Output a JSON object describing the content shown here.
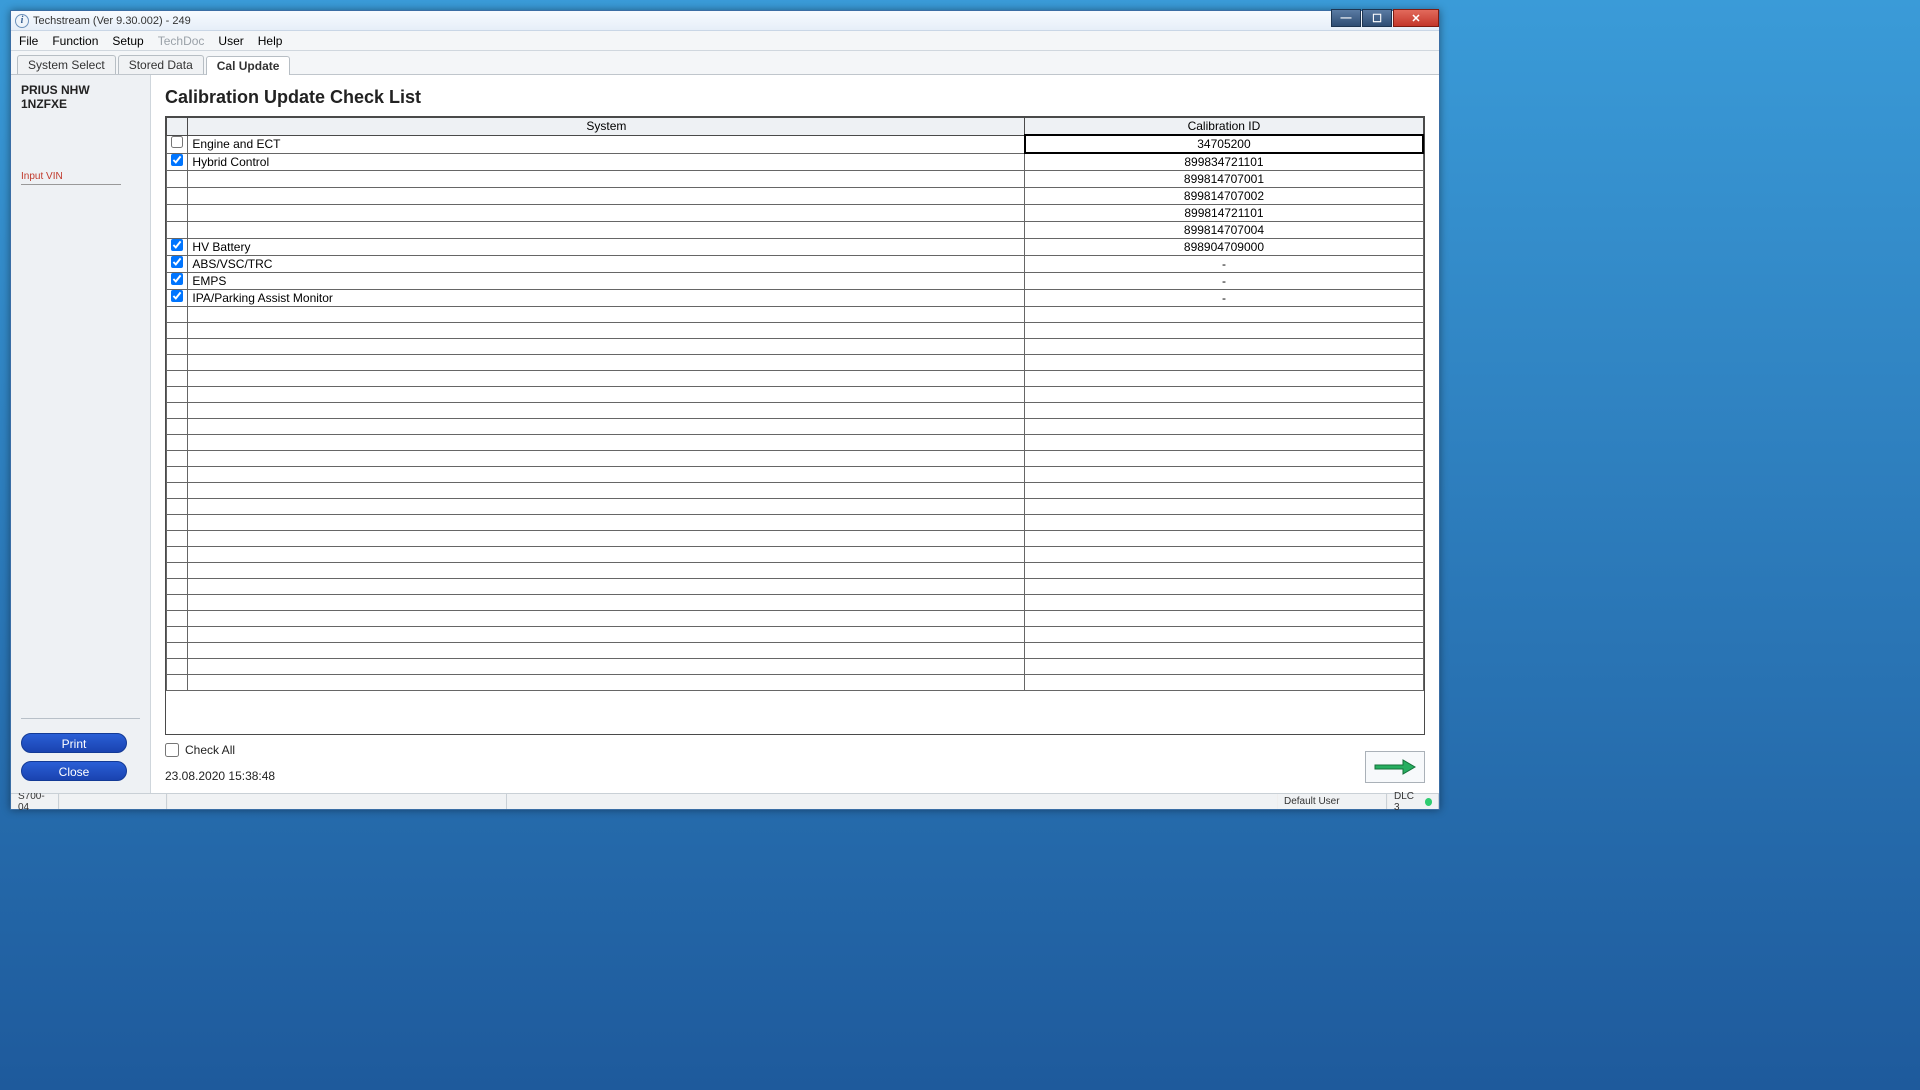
{
  "window": {
    "title": "Techstream (Ver 9.30.002) - 249"
  },
  "menu": {
    "items": [
      {
        "label": "File",
        "disabled": false
      },
      {
        "label": "Function",
        "disabled": false
      },
      {
        "label": "Setup",
        "disabled": false
      },
      {
        "label": "TechDoc",
        "disabled": true
      },
      {
        "label": "User",
        "disabled": false
      },
      {
        "label": "Help",
        "disabled": false
      }
    ]
  },
  "tabs": [
    {
      "label": "System Select",
      "active": false
    },
    {
      "label": "Stored Data",
      "active": false
    },
    {
      "label": "Cal Update",
      "active": true
    }
  ],
  "sidebar": {
    "vehicle_line1": "PRIUS NHW",
    "vehicle_line2": "1NZFXE",
    "input_vin_label": "Input VIN",
    "print_label": "Print",
    "close_label": "Close"
  },
  "main": {
    "title": "Calibration Update Check List",
    "columns": {
      "system": "System",
      "cal_id": "Calibration ID"
    },
    "rows": [
      {
        "checked": false,
        "system": "Engine and ECT",
        "cal": "34705200",
        "highlight": true
      },
      {
        "checked": true,
        "system": "Hybrid Control",
        "cal": "899834721101"
      },
      {
        "checked": null,
        "system": "",
        "cal": "899814707001"
      },
      {
        "checked": null,
        "system": "",
        "cal": "899814707002"
      },
      {
        "checked": null,
        "system": "",
        "cal": "899814721101"
      },
      {
        "checked": null,
        "system": "",
        "cal": "899814707004"
      },
      {
        "checked": true,
        "system": "HV Battery",
        "cal": "898904709000"
      },
      {
        "checked": true,
        "system": "ABS/VSC/TRC",
        "cal": "-"
      },
      {
        "checked": true,
        "system": "EMPS",
        "cal": "-"
      },
      {
        "checked": true,
        "system": "IPA/Parking Assist Monitor",
        "cal": "-"
      }
    ],
    "empty_rows": 24,
    "check_all_label": "Check All",
    "timestamp": "23.08.2020 15:38:48"
  },
  "statusbar": {
    "left": "S700-04",
    "user": "Default User",
    "dlc": "DLC 3"
  }
}
